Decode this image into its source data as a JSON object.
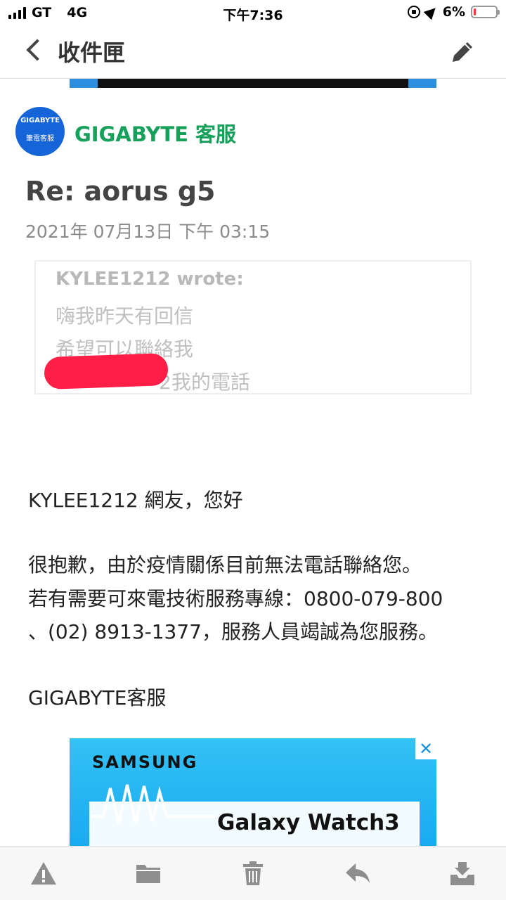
{
  "status_bar": {
    "carrier": "GT",
    "network": "4G",
    "time": "下午7:36",
    "battery_percent": "6%",
    "battery_level": 0.06,
    "icons": [
      "signal-icon",
      "rotation-lock-icon",
      "location-arrow-icon",
      "battery-icon"
    ]
  },
  "nav": {
    "back_icon": "chevron-left-icon",
    "title": "收件匣",
    "edit_icon": "pencil-icon"
  },
  "sender": {
    "avatar_line1": "GIGABYTE",
    "avatar_line2": "筆電客服",
    "name": "GIGABYTE 客服",
    "name_color": "#16a05a",
    "avatar_color": "#1565d8"
  },
  "email": {
    "subject": "Re: aorus g5",
    "date": "2021年 07月13日 下午 03:15"
  },
  "quote": {
    "header": "KYLEE1212 wrote:",
    "lines": [
      "嗨我昨天有回信",
      "希望可以聯絡我",
      "2我的電話"
    ]
  },
  "body": {
    "greeting": "KYLEE1212 網友，您好",
    "para_lines": [
      "很抱歉，由於疫情關係目前無法電話聯絡您。",
      "若有需要可來電技術服務專線：0800-079-800",
      "、(02) 8913-1377，服務人員竭誠為您服務。"
    ],
    "signature": "GIGABYTE客服"
  },
  "ad": {
    "brand": "SAMSUNG",
    "product": "Galaxy Watch3",
    "close_label": "✕",
    "bg_color": "#19a9f0"
  },
  "toolbar": {
    "buttons": [
      {
        "icon": "warning-icon"
      },
      {
        "icon": "folder-icon"
      },
      {
        "icon": "trash-icon"
      },
      {
        "icon": "reply-icon"
      },
      {
        "icon": "inbox-icon"
      }
    ]
  }
}
